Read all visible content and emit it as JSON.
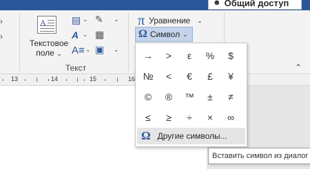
{
  "header": {
    "share_label": "Общий доступ",
    "share_icon": "person-icon"
  },
  "ribbon": {
    "textbox_label_line1": "Текстовое",
    "textbox_label_line2": "поле",
    "group_label": "Текст",
    "equation_label": "Уравнение",
    "equation_icon_glyph": "π",
    "symbol_label": "Символ",
    "symbol_icon_glyph": "Ω",
    "accent_color": "#2b579a",
    "pressed_button_color": "#c5d4ea"
  },
  "ruler": {
    "numbers": [
      "13",
      "14",
      "15",
      "16"
    ]
  },
  "symbol_menu": {
    "symbols": [
      "→",
      ">",
      "ε",
      "%",
      "$",
      "№",
      "<",
      "€",
      "£",
      "¥",
      "©",
      "®",
      "™",
      "±",
      "≠",
      "≤",
      "≥",
      "÷",
      "×",
      "∞"
    ],
    "more_label": "Другие символы...",
    "more_icon_glyph": "Ω"
  },
  "tooltip": {
    "text": "Вставить символ из диалог"
  }
}
